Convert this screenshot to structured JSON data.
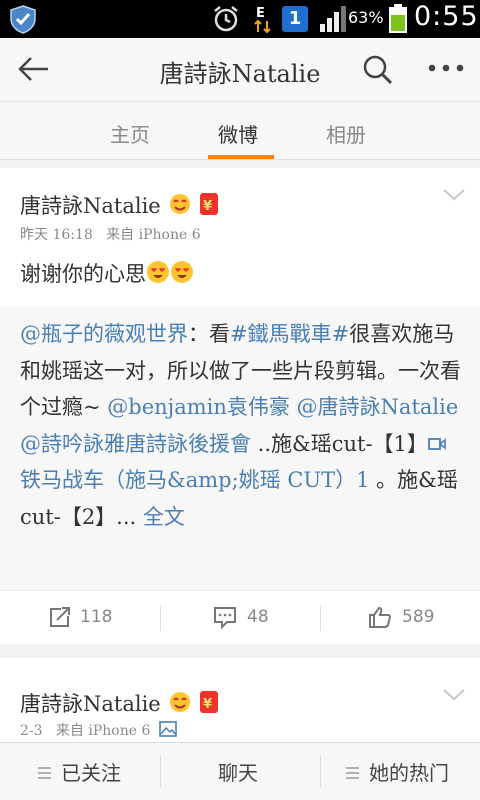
{
  "status_bar": {
    "battery_percent": "63%",
    "time": "0:55",
    "badge": "1"
  },
  "nav": {
    "title": "唐詩詠Natalie"
  },
  "tabs": [
    {
      "label": "主页"
    },
    {
      "label": "微博"
    },
    {
      "label": "相册"
    }
  ],
  "active_tab": "微博",
  "colors": {
    "accent": "#ff8200",
    "link": "#4a7fb5"
  },
  "post": {
    "username": "唐詩詠Natalie",
    "time": "昨天 16:18",
    "source": "来自 iPhone 6",
    "text": "谢谢你的心思",
    "emojis": [
      "heart-eyes-emoji",
      "heart-eyes-emoji"
    ],
    "retweet": {
      "author": "@瓶子的薇观世界",
      "body_1": "：看",
      "hashtag": "#鐵馬戰車#",
      "body_2": "很喜欢施马和姚瑶这一对，所以做了一些片段剪辑。一次看个过瘾~ ",
      "mention_1": "@benjamin袁伟豪",
      "space_1": " ",
      "mention_2": "@唐詩詠Natalie",
      "space_2": " ",
      "mention_3": "@詩吟詠雅唐詩詠後援會",
      "body_3": " ..施&瑶cut-【1】",
      "video_link": "铁马战车（施马&amp;姚瑶 CUT）1",
      "body_4": " 。施&瑶cut-【2】... ",
      "expand": "全文"
    },
    "reposts": "118",
    "comments": "48",
    "likes": "589"
  },
  "post2": {
    "username": "唐詩詠Natalie",
    "time": "2-3",
    "source": "来自 iPhone 6"
  },
  "bottom_bar": {
    "followed": "已关注",
    "chat": "聊天",
    "her_hot": "她的热门"
  }
}
